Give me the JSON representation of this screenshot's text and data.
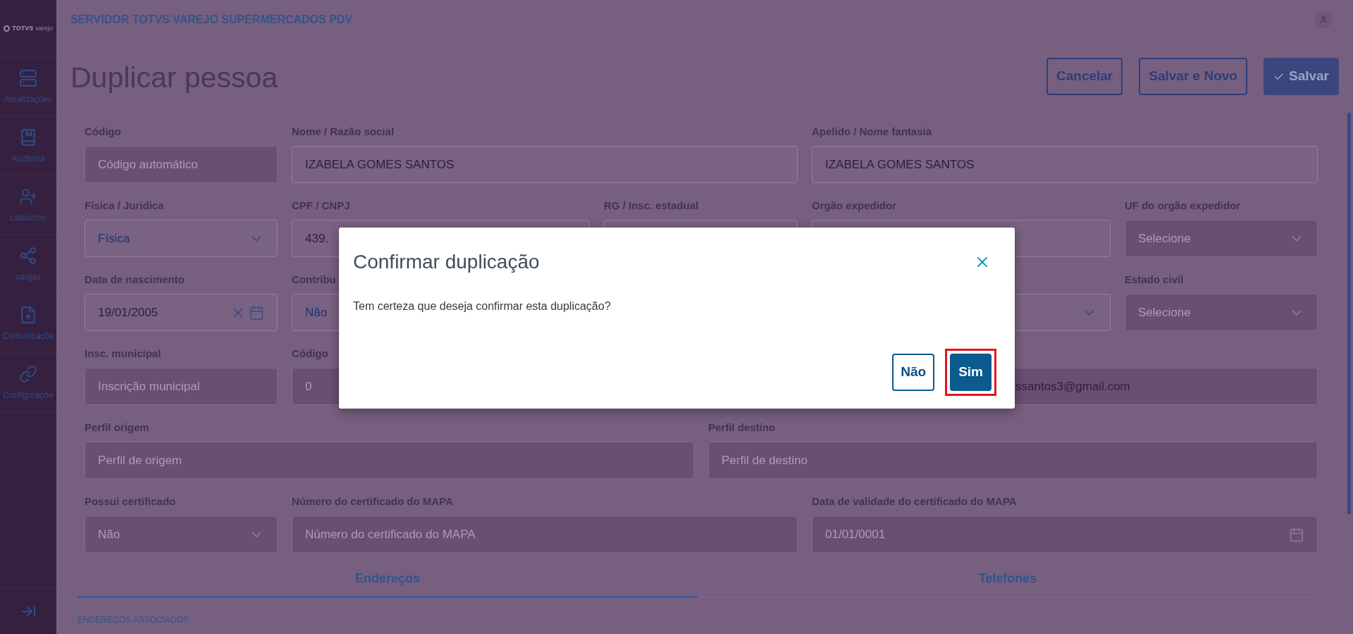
{
  "sidebar": {
    "logo": {
      "brand": "TOTVS",
      "sub": "varejo"
    },
    "items": [
      {
        "label": "Atualizações"
      },
      {
        "label": "Auditoria"
      },
      {
        "label": "cadastros"
      },
      {
        "label": "cargas"
      },
      {
        "label": "Comunicaçõe"
      },
      {
        "label": "Configuraçõe"
      }
    ]
  },
  "header": {
    "title": "SERVIDOR TOTVS VAREJO SUPERMERCADOS PDV"
  },
  "page": {
    "title": "Duplicar pessoa",
    "buttons": [
      {
        "label": "Cancelar",
        "kind": "outline"
      },
      {
        "label": "Salvar e Novo",
        "kind": "outline"
      },
      {
        "label": "Salvar",
        "kind": "primary"
      }
    ]
  },
  "form": {
    "fields": [
      {
        "label": "Código",
        "placeholder": "Código automático",
        "kind": "text",
        "disabled": true
      },
      {
        "label": "Nome / Razão social",
        "value": "IZABELA GOMES SANTOS",
        "kind": "text",
        "disabled": false
      },
      {
        "label": "Apelido / Nome fantasia",
        "value": "IZABELA GOMES SANTOS",
        "kind": "text",
        "disabled": false
      },
      {
        "label": "Física / Juridica",
        "value": "Física",
        "kind": "select",
        "disabled": false
      },
      {
        "label": "CPF / CNPJ",
        "value": "439.",
        "kind": "text",
        "disabled": false
      },
      {
        "label": "RG / Insc. estadual",
        "kind": "text",
        "disabled": false
      },
      {
        "label": "Orgão expedidor",
        "kind": "text",
        "disabled": false
      },
      {
        "label": "UF do orgão expedidor",
        "placeholder": "Selecione",
        "kind": "select",
        "disabled": true
      },
      {
        "label": "Data de nascimento",
        "value": "19/01/2005",
        "kind": "date",
        "disabled": false
      },
      {
        "label": "Contribu",
        "value": "Não",
        "kind": "select",
        "disabled": false
      },
      {
        "kind": "select",
        "disabled": false
      },
      {
        "label": "Estado civil",
        "placeholder": "Selecione",
        "kind": "select",
        "disabled": true
      },
      {
        "label": "Insc. municipal",
        "placeholder": "Inscrição municipal",
        "kind": "text",
        "disabled": true
      },
      {
        "label": "Código",
        "placeholder": "0",
        "kind": "text",
        "disabled": true
      },
      {
        "value": "ssantos3@gmail.com",
        "kind": "text",
        "disabled": true
      },
      {
        "label": "Perfil origem",
        "placeholder": "Perfil de origem",
        "kind": "text",
        "disabled": true
      },
      {
        "label": "Perfil destino",
        "placeholder": "Perfil de destino",
        "kind": "text",
        "disabled": true
      },
      {
        "label": "Possui certificado",
        "placeholder": "Não",
        "kind": "select",
        "disabled": true
      },
      {
        "label": "Número do certificado do MAPA",
        "placeholder": "Número do certificado do MAPA",
        "kind": "text",
        "disabled": true
      },
      {
        "label": "Data de validade do certificado do MAPA",
        "placeholder": "01/01/0001",
        "kind": "date",
        "disabled": true
      }
    ]
  },
  "tabs": [
    {
      "label": "Endereços",
      "selected": true
    },
    {
      "label": "Telefones",
      "selected": false
    }
  ],
  "section_title": "ENDEREÇOS ASSOCIADOS",
  "dialog": {
    "title": "Confirmar duplicação",
    "message": "Tem certeza que deseja confirmar esta duplicação?",
    "buttons": [
      {
        "label": "Não",
        "kind": "outline",
        "highlighted": false
      },
      {
        "label": "Sim",
        "kind": "primary",
        "highlighted": true
      }
    ]
  }
}
